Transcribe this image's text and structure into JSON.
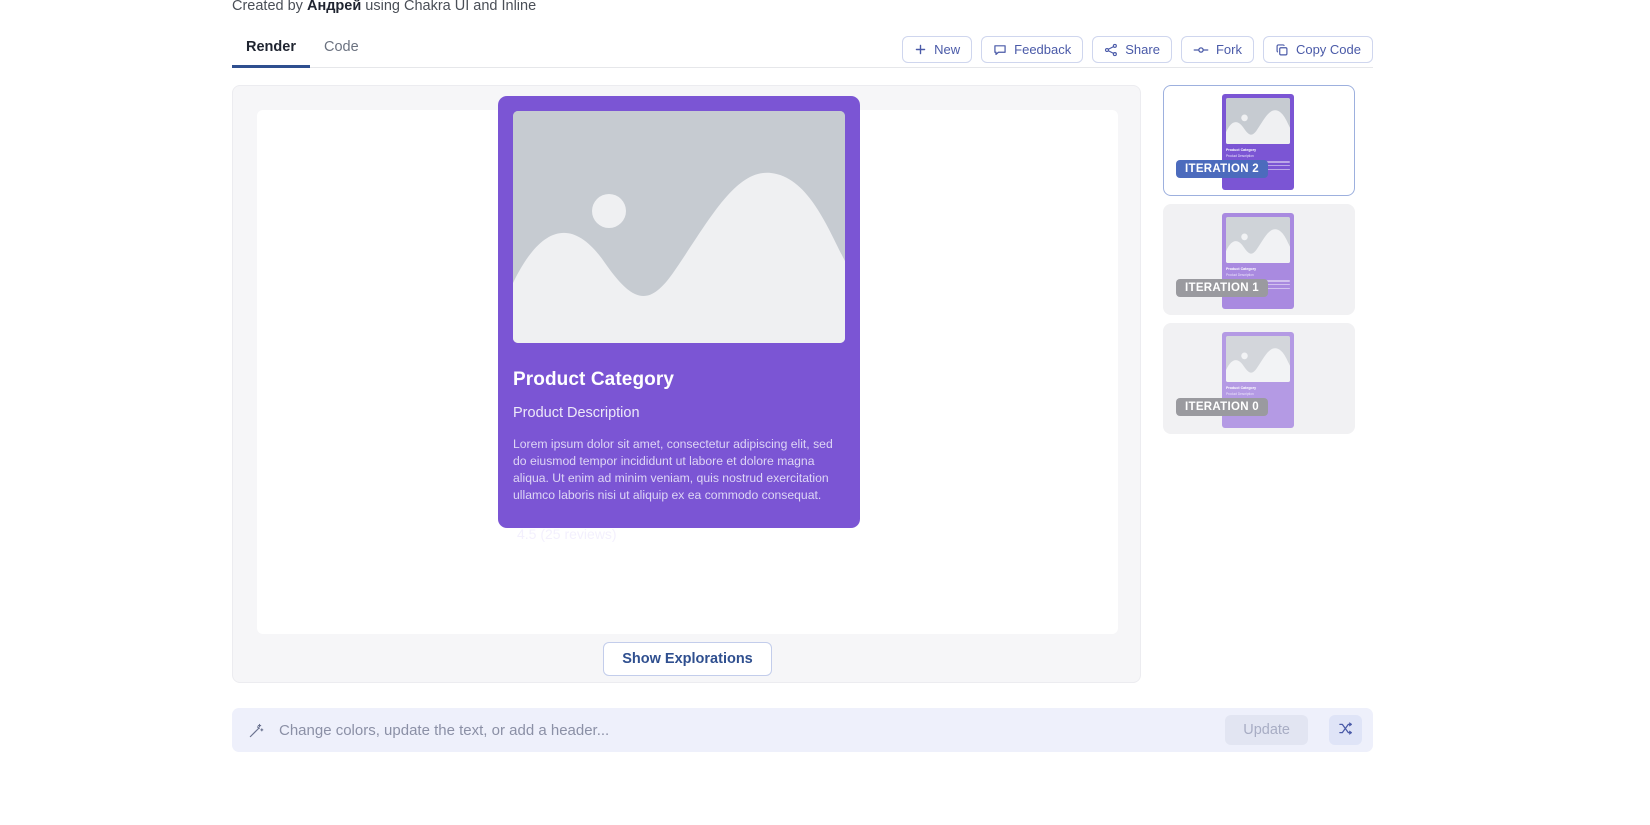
{
  "credit": {
    "prefix": "Created by ",
    "author": "Андрей",
    "suffix": " using Chakra UI and Inline"
  },
  "tabs": [
    {
      "label": "Render",
      "active": true
    },
    {
      "label": "Code",
      "active": false
    }
  ],
  "toolbar": {
    "buttons": [
      {
        "label": "New",
        "icon": "plus-icon"
      },
      {
        "label": "Feedback",
        "icon": "comment-icon"
      },
      {
        "label": "Share",
        "icon": "share-nodes-icon"
      },
      {
        "label": "Fork",
        "icon": "fork-icon"
      },
      {
        "label": "Copy Code",
        "icon": "copy-icon"
      }
    ]
  },
  "card": {
    "title": "Product Category",
    "subtitle": "Product Description",
    "body": "Lorem ipsum dolor sit amet, consectetur adipiscing elit, sed do eiusmod tempor incididunt ut labore et dolore magna aliqua. Ut enim ad minim veniam, quis nostrud exercitation ullamco laboris nisi ut aliquip ex ea commodo consequat.",
    "rating": "4.5 (25 reviews)",
    "accent_color": "#7b55d4",
    "image_placeholder": "image-placeholder-icon"
  },
  "explorations": {
    "button_label": "Show Explorations"
  },
  "iterations": [
    {
      "label": "ITERATION 2",
      "selected": true,
      "badge_color": "#4c6bbd",
      "thumb_tone": "strong"
    },
    {
      "label": "ITERATION 1",
      "selected": false,
      "badge_color": "#9a9a9f",
      "thumb_tone": "faded"
    },
    {
      "label": "ITERATION 0",
      "selected": false,
      "badge_color": "#9a9a9f",
      "thumb_tone": "faded2"
    }
  ],
  "thumb_card": {
    "title": "Product Category",
    "subtitle": "Product Description"
  },
  "prompt": {
    "placeholder": "Change colors, update the text, or add a header...",
    "value": "",
    "wand_icon": "magic-wand-icon",
    "update_label": "Update",
    "shuffle_icon": "shuffle-icon"
  }
}
